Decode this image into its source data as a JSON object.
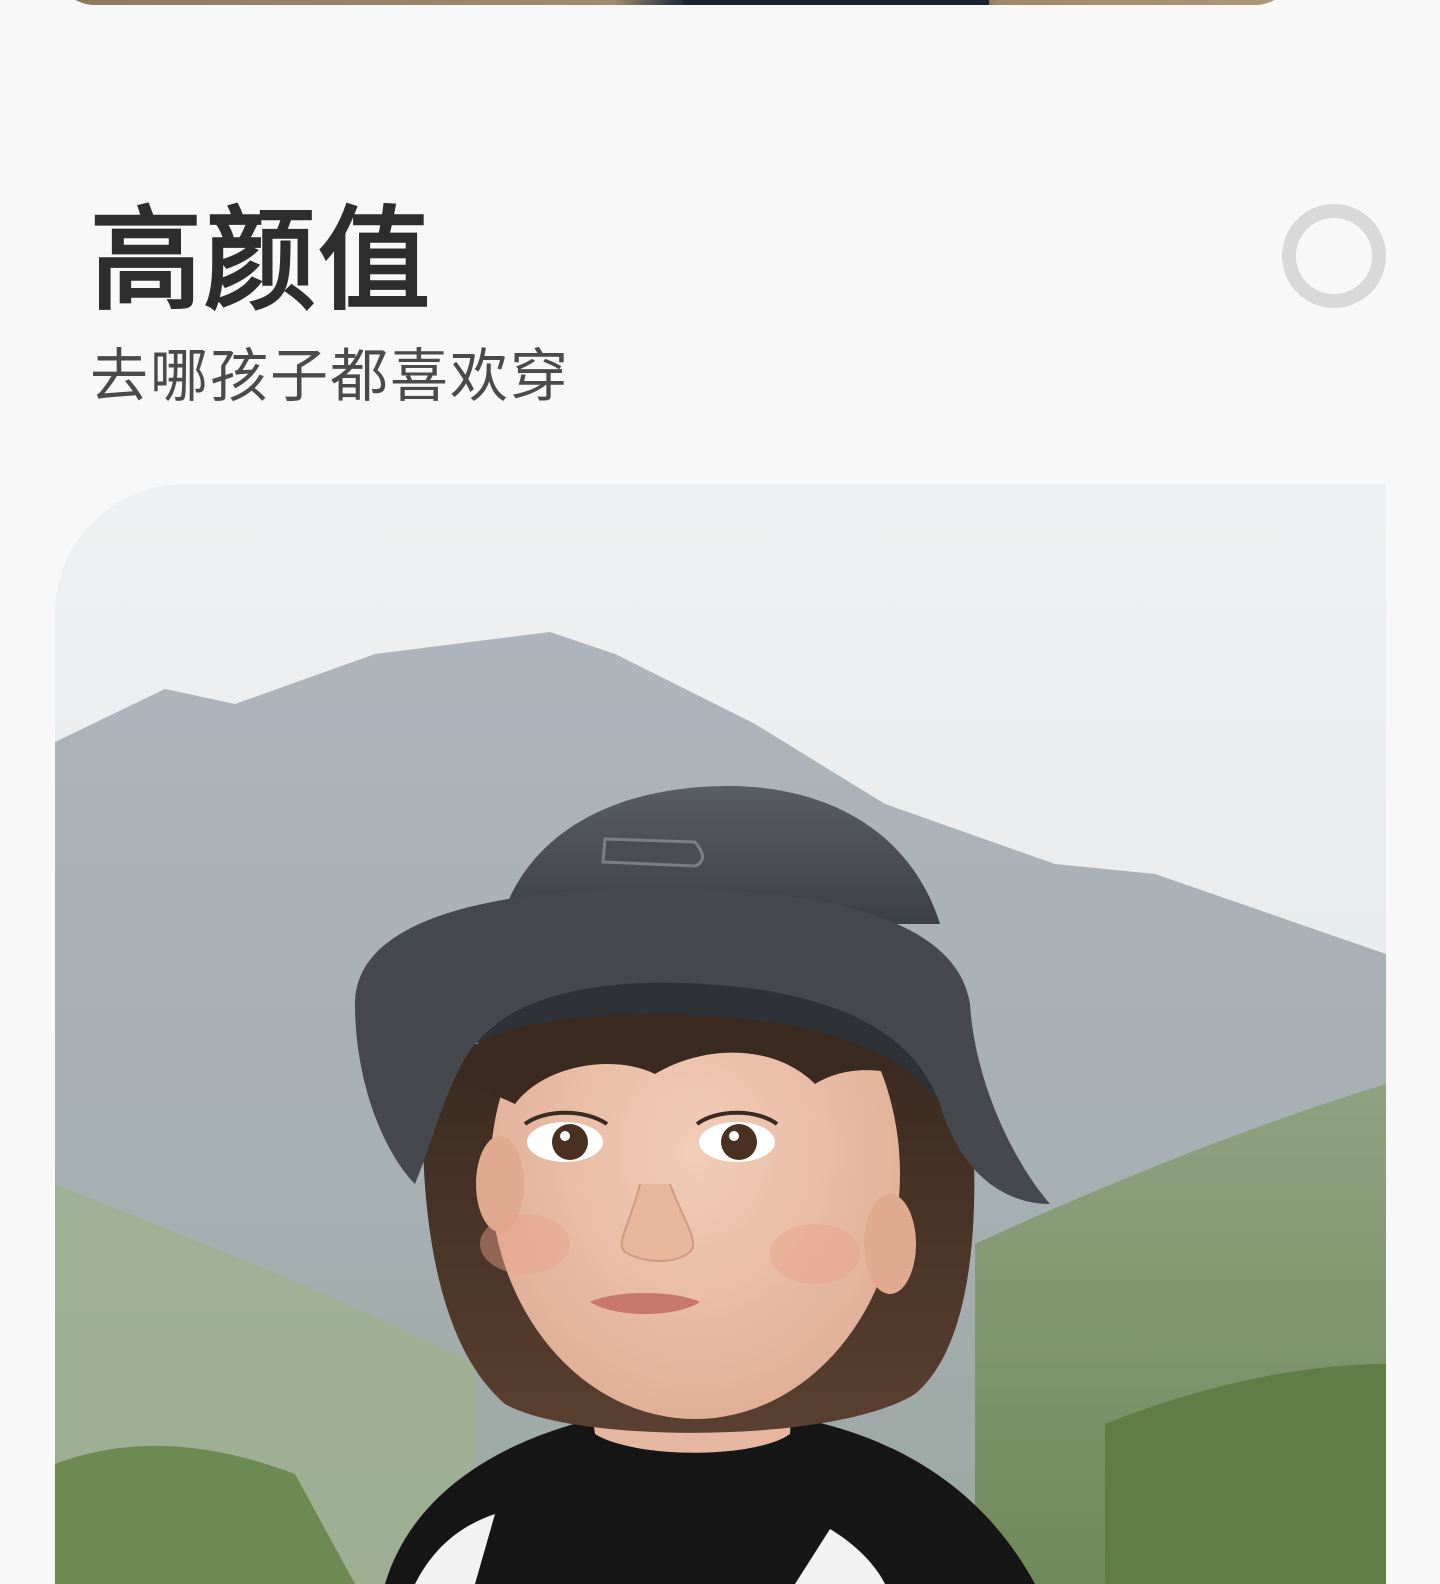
{
  "section": {
    "title": "高颜值",
    "subtitle": "去哪孩子都喜欢穿"
  },
  "icons": {
    "decoration": "ring-icon"
  },
  "photos": {
    "previous": "outdoor-product-photo",
    "main": "child-in-bucket-hat-mountain-photo"
  },
  "colors": {
    "background": "#f8f8f8",
    "title": "#2d2d2d",
    "subtitle": "#4a4a4a",
    "ring": "#d9d9d9"
  }
}
